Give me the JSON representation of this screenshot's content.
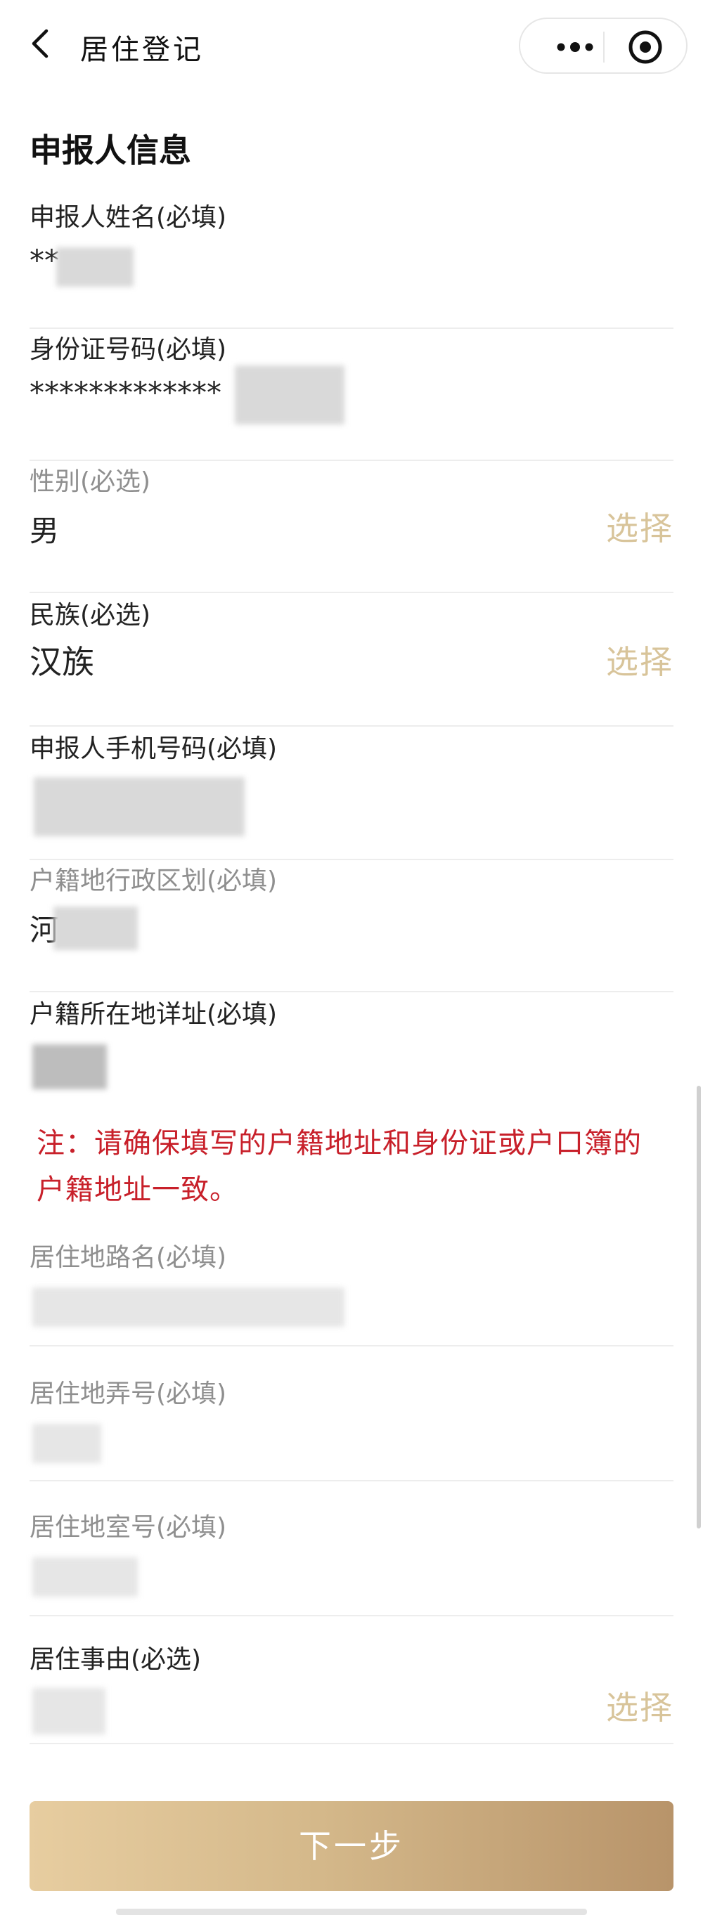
{
  "header": {
    "title": "居住登记"
  },
  "section": {
    "title": "申报人信息"
  },
  "fields": [
    {
      "label": "申报人姓名(必填)",
      "value": "**"
    },
    {
      "label": "身份证号码(必填)",
      "value": "*************"
    },
    {
      "label": "性别(必选)",
      "value": "男",
      "action": "选择"
    },
    {
      "label": "民族(必选)",
      "value": "汉族",
      "action": "选择"
    },
    {
      "label": "申报人手机号码(必填)",
      "value": ""
    },
    {
      "label": "户籍地行政区划(必填)",
      "value": "河"
    },
    {
      "label": "户籍所在地详址(必填)",
      "value": ""
    },
    {
      "label": "居住地路名(必填)",
      "value": ""
    },
    {
      "label": "居住地弄号(必填)",
      "value": ""
    },
    {
      "label": "居住地室号(必填)",
      "value": ""
    },
    {
      "label": "居住事由(必选)",
      "value": "",
      "action": "选择"
    }
  ],
  "note": "注：请确保填写的户籍地址和身份证或户口簿的户籍地址一致。",
  "footer": {
    "next_label": "下一步"
  },
  "colors": {
    "accent": "#d8c49a",
    "button_start": "#e7cda0",
    "button_end": "#b8946a",
    "warning": "#c8202a"
  },
  "icons": [
    "back-arrow-icon",
    "more-dots-icon",
    "close-target-icon"
  ]
}
